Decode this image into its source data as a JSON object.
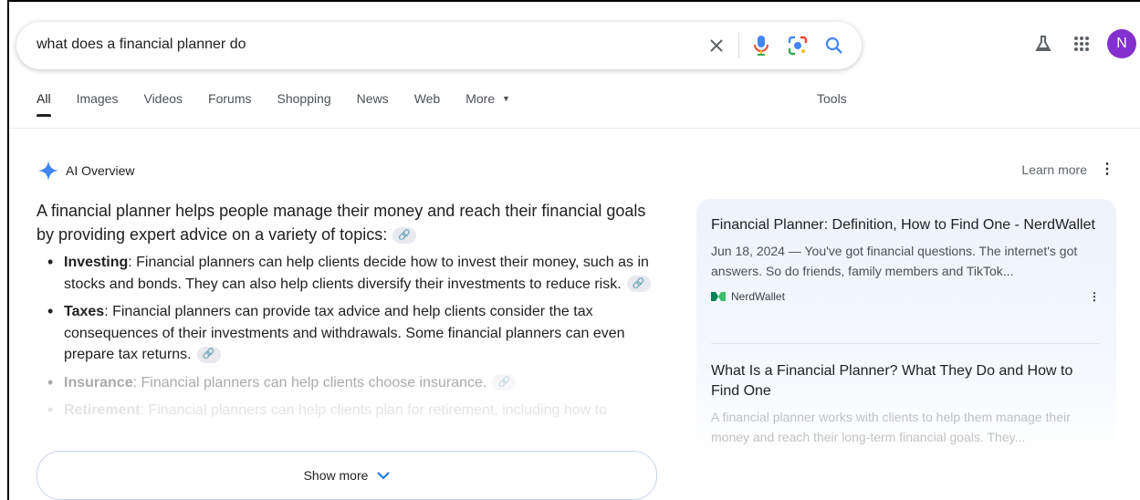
{
  "search": {
    "query": "what does a financial planner do",
    "icons": [
      "clear-icon",
      "microphone-icon",
      "lens-icon",
      "search-icon"
    ]
  },
  "header": {
    "avatar_letter": "N",
    "icons": [
      "labs-flask-icon",
      "apps-grid-icon"
    ]
  },
  "tabs": [
    {
      "label": "All",
      "active": true
    },
    {
      "label": "Images"
    },
    {
      "label": "Videos"
    },
    {
      "label": "Forums"
    },
    {
      "label": "Shopping"
    },
    {
      "label": "News"
    },
    {
      "label": "Web"
    },
    {
      "label": "More"
    }
  ],
  "tools_label": "Tools",
  "ai_overview": {
    "title": "AI Overview",
    "learn_more": "Learn more",
    "lead": "A financial planner helps people manage their money and reach their financial goals by providing expert advice on a variety of topics:",
    "bullets": [
      {
        "term": "Investing",
        "text": ": Financial planners can help clients decide how to invest their money, such as in stocks and bonds. They can also help clients diversify their investments to reduce risk."
      },
      {
        "term": "Taxes",
        "text": ": Financial planners can provide tax advice and help clients consider the tax consequences of their investments and withdrawals. Some financial planners can even prepare tax returns."
      },
      {
        "term": "Insurance",
        "text": ": Financial planners can help clients choose insurance."
      },
      {
        "term": "Retirement",
        "text": ": Financial planners can help clients plan for retirement, including how to"
      }
    ],
    "show_more": "Show more"
  },
  "sources": [
    {
      "title": "Financial Planner: Definition, How to Find One - NerdWallet",
      "snippet": "Jun 18, 2024 — You've got financial questions. The internet's got answers. So do friends, family members and TikTok...",
      "site": "NerdWallet"
    },
    {
      "title": "What Is a Financial Planner? What They Do and How to Find One",
      "snippet": "A financial planner works with clients to help them manage their money and reach their long-term financial goals. They..."
    }
  ],
  "colors": {
    "accent_blue": "#1a73e8",
    "avatar_bg": "#8430ce",
    "gemini_blue": "#4285f4"
  }
}
